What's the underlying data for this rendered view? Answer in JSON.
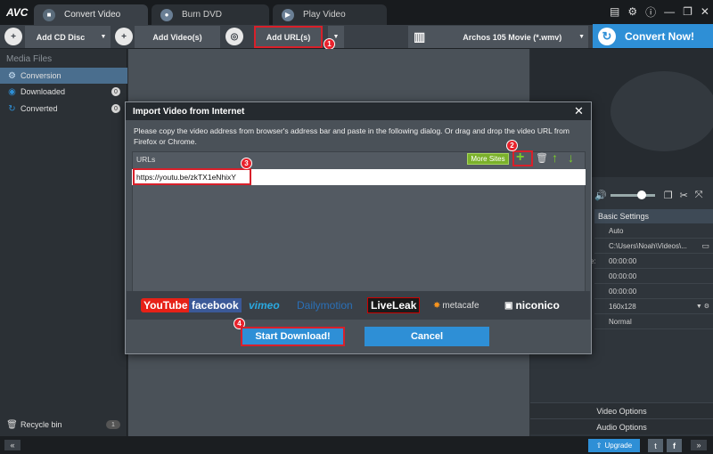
{
  "app": {
    "logo": "AVC"
  },
  "tabs": [
    {
      "label": "Convert Video",
      "icon": "film-icon"
    },
    {
      "label": "Burn DVD",
      "icon": "disc-icon"
    },
    {
      "label": "Play Video",
      "icon": "play-icon"
    }
  ],
  "toolbar": {
    "add_cd": "Add CD Disc",
    "add_video": "Add Video(s)",
    "add_url": "Add URL(s)",
    "profile": "Archos 105 Movie (*.wmv)",
    "convert_now": "Convert Now!"
  },
  "sidebar": {
    "header": "Media Files",
    "items": [
      {
        "label": "Conversion",
        "badge": ""
      },
      {
        "label": "Downloaded",
        "badge": "0"
      },
      {
        "label": "Converted",
        "badge": "0"
      }
    ],
    "recycle": {
      "label": "Recycle bin",
      "count": "1"
    }
  },
  "right_panel": {
    "section_title": "Basic Settings",
    "rows": [
      "Auto",
      "C:\\Users\\Noah\\Videos\\...",
      "00:00:00",
      "00:00:00",
      "00:00:00",
      "160x128",
      "Normal"
    ],
    "row_fragment": "e:",
    "video_options": "Video Options",
    "audio_options": "Audio Options",
    "upgrade": "Upgrade"
  },
  "dialog": {
    "title": "Import Video from Internet",
    "instruction": "Please copy the video address from browser's address bar and paste in the following dialog. Or drag and drop the video URL from Firefox or Chrome.",
    "urls_label": "URLs",
    "more_sites": "More Sites",
    "url_value": "https://youtu.be/zkTX1eNhixY",
    "start_download": "Start Download!",
    "cancel": "Cancel",
    "sites": [
      "YouTube",
      "facebook",
      "vimeo",
      "Dailymotion",
      "LiveLeak",
      "metacafe",
      "niconico"
    ]
  },
  "steps": [
    "1",
    "2",
    "3",
    "4"
  ],
  "colors": {
    "accent_blue": "#2e8fd6",
    "highlight_red": "#d8202a",
    "more_sites_green": "#7bb12b"
  }
}
